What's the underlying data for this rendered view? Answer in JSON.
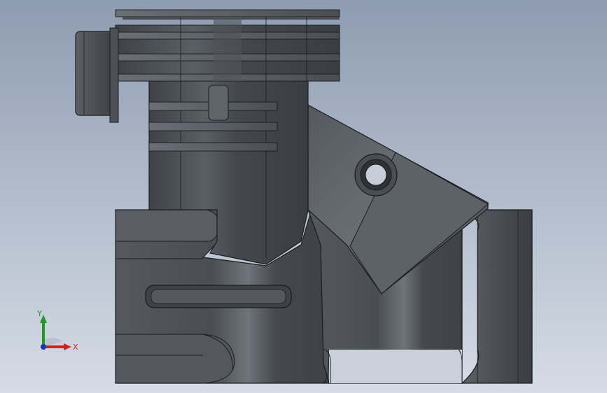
{
  "viewport": {
    "background_top": "#8e9cb1",
    "background_bottom": "#d6dce6"
  },
  "model": {
    "body_color": "#4e5257",
    "edge_color": "#1a1c1f",
    "highlight_color": "#6b7077"
  },
  "triad": {
    "x_label": "X",
    "y_label": "Y",
    "x_color": "#d21f1f",
    "y_color": "#1f9a2a",
    "z_color": "#1f2fb8"
  }
}
